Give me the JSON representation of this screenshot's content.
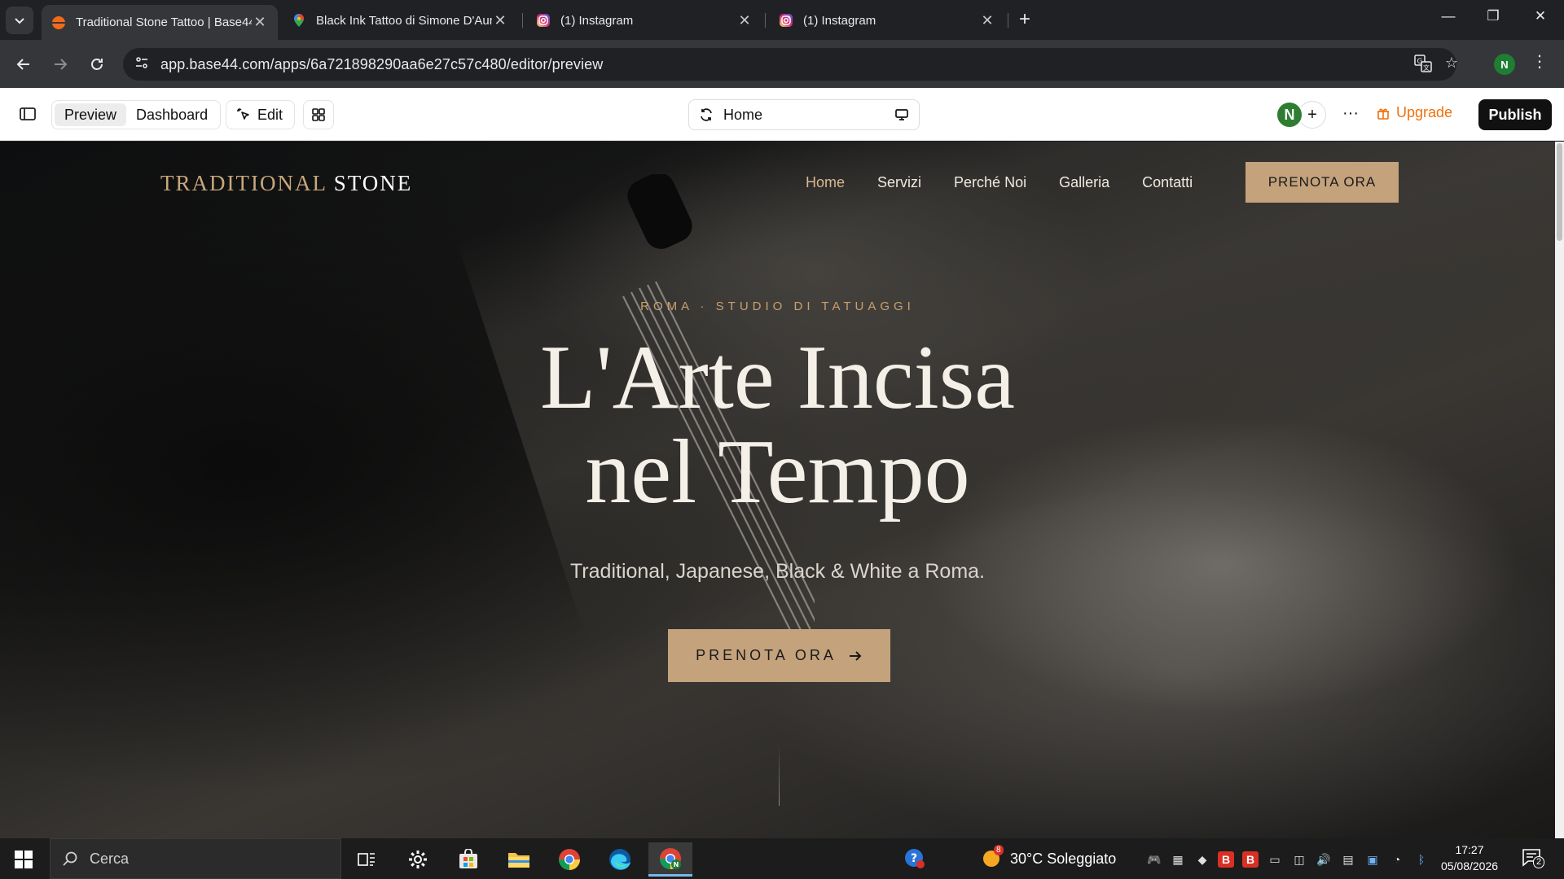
{
  "browser": {
    "tabs": [
      {
        "title": "Traditional Stone Tattoo | Base44",
        "active": true
      },
      {
        "title": "Black Ink Tattoo di Simone D'Auria",
        "active": false
      },
      {
        "title": "(1) Instagram",
        "active": false
      },
      {
        "title": "(1) Instagram",
        "active": false
      }
    ],
    "url": "app.base44.com/apps/6a721898290aa6e27c57c480/editor/preview",
    "profile_initial": "N"
  },
  "editor": {
    "preview_label": "Preview",
    "dashboard_label": "Dashboard",
    "edit_label": "Edit",
    "page_selector": "Home",
    "avatar_initial": "N",
    "upgrade_label": "Upgrade",
    "publish_label": "Publish"
  },
  "site": {
    "logo_light": "TRADITIONAL",
    "logo_bold": "STONE",
    "nav": [
      "Home",
      "Servizi",
      "Perché Noi",
      "Galleria",
      "Contatti"
    ],
    "nav_cta": "PRENOTA ORA",
    "eyebrow": "ROMA · STUDIO DI TATUAGGI",
    "headline_line1": "L'Arte Incisa",
    "headline_line2": "nel Tempo",
    "subheadline": "Traditional, Japanese, Black & White a Roma.",
    "hero_cta": "PRENOTA ORA"
  },
  "taskbar": {
    "search_placeholder": "Cerca",
    "weather_badge": "8",
    "weather_text": "30°C  Soleggiato",
    "time": "17:27",
    "date": "05/08/2026",
    "notification_count": "2"
  },
  "colors": {
    "accent_gold": "#c4a27c",
    "upgrade_orange": "#f0700a",
    "chrome_dark": "#202124",
    "chrome_toolbar": "#35363a"
  }
}
